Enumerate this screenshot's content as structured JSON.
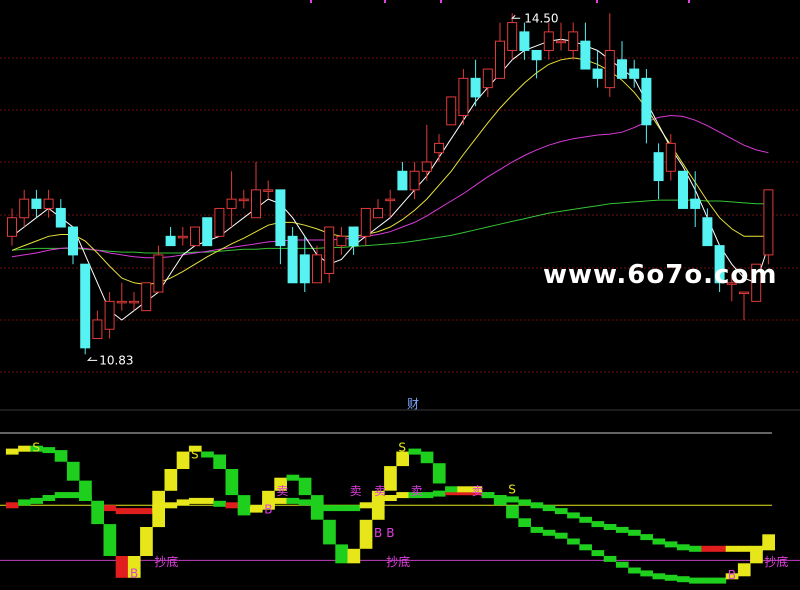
{
  "colors": {
    "background": "#000000",
    "grid": "#6e0f0f",
    "up": "#e03a3a",
    "down": "#57f2f2",
    "ma5": "#ffffff",
    "ma10": "#e8e23a",
    "ma20": "#d93ad9",
    "ma60": "#35c435",
    "green_step": "#1ecf1e",
    "yellow_step": "#e6e61a",
    "red_step": "#e01e1e",
    "magenta_text": "#e040e0",
    "yellow_line": "#e6e61a",
    "magenta_line": "#c040c0",
    "ref_line": "#c8c8c8"
  },
  "watermark": "www.6o7o.com",
  "middle_label": "财",
  "chart_data": [
    {
      "type": "candlestick",
      "price_range": [
        10.5,
        14.6
      ],
      "max_label": "14.50",
      "min_label": "10.83",
      "ohlc": [
        [
          12.1,
          12.4,
          12.0,
          12.3
        ],
        [
          12.3,
          12.6,
          12.2,
          12.5
        ],
        [
          12.5,
          12.6,
          12.3,
          12.4
        ],
        [
          12.4,
          12.6,
          12.3,
          12.5
        ],
        [
          12.4,
          12.5,
          12.2,
          12.2
        ],
        [
          12.2,
          12.2,
          11.8,
          11.9
        ],
        [
          11.8,
          11.8,
          10.83,
          10.9
        ],
        [
          11.0,
          11.3,
          11.0,
          11.2
        ],
        [
          11.1,
          11.5,
          11.0,
          11.4
        ],
        [
          11.4,
          11.6,
          11.3,
          11.4
        ],
        [
          11.4,
          11.5,
          11.3,
          11.4
        ],
        [
          11.3,
          11.6,
          11.3,
          11.6
        ],
        [
          11.5,
          12.0,
          11.5,
          11.9
        ],
        [
          12.1,
          12.2,
          12.0,
          12.0
        ],
        [
          12.1,
          12.2,
          12.0,
          12.1
        ],
        [
          12.0,
          12.2,
          12.0,
          12.2
        ],
        [
          12.3,
          12.3,
          12.0,
          12.0
        ],
        [
          12.1,
          12.4,
          12.1,
          12.4
        ],
        [
          12.4,
          12.8,
          12.2,
          12.5
        ],
        [
          12.5,
          12.6,
          12.4,
          12.5
        ],
        [
          12.3,
          12.9,
          12.3,
          12.6
        ],
        [
          12.6,
          12.7,
          12.5,
          12.6
        ],
        [
          12.6,
          12.6,
          11.8,
          12.0
        ],
        [
          12.1,
          12.2,
          11.6,
          11.6
        ],
        [
          11.9,
          12.1,
          11.5,
          11.6
        ],
        [
          11.6,
          12.0,
          11.6,
          11.9
        ],
        [
          11.7,
          12.2,
          11.6,
          12.2
        ],
        [
          12.0,
          12.2,
          11.9,
          12.1
        ],
        [
          12.2,
          12.2,
          11.9,
          12.0
        ],
        [
          12.1,
          12.4,
          12.0,
          12.4
        ],
        [
          12.3,
          12.5,
          12.3,
          12.4
        ],
        [
          12.5,
          12.6,
          12.3,
          12.5
        ],
        [
          12.8,
          12.9,
          12.6,
          12.6
        ],
        [
          12.6,
          12.9,
          12.5,
          12.8
        ],
        [
          12.8,
          13.3,
          12.7,
          12.9
        ],
        [
          13.0,
          13.2,
          12.9,
          13.1
        ],
        [
          13.3,
          13.6,
          13.3,
          13.6
        ],
        [
          13.4,
          13.9,
          13.3,
          13.8
        ],
        [
          13.8,
          14.0,
          13.5,
          13.6
        ],
        [
          13.7,
          13.9,
          13.6,
          13.9
        ],
        [
          13.8,
          14.4,
          13.8,
          14.2
        ],
        [
          14.1,
          14.5,
          14.0,
          14.4
        ],
        [
          14.3,
          14.4,
          14.0,
          14.1
        ],
        [
          14.1,
          14.1,
          13.8,
          14.0
        ],
        [
          14.1,
          14.4,
          14.0,
          14.3
        ],
        [
          14.2,
          14.4,
          14.1,
          14.2
        ],
        [
          14.1,
          14.4,
          14.0,
          14.3
        ],
        [
          14.2,
          14.4,
          14.0,
          13.9
        ],
        [
          13.9,
          14.1,
          13.7,
          13.8
        ],
        [
          13.7,
          14.5,
          13.6,
          14.1
        ],
        [
          14.0,
          14.2,
          13.8,
          13.8
        ],
        [
          13.9,
          14.0,
          13.7,
          13.8
        ],
        [
          13.8,
          13.9,
          13.1,
          13.3
        ],
        [
          13.0,
          13.1,
          12.5,
          12.7
        ],
        [
          12.8,
          13.2,
          12.7,
          13.1
        ],
        [
          12.8,
          12.8,
          12.4,
          12.4
        ],
        [
          12.5,
          12.8,
          12.2,
          12.4
        ],
        [
          12.3,
          12.4,
          12.0,
          12.0
        ],
        [
          12.0,
          12.0,
          11.5,
          11.6
        ],
        [
          11.6,
          11.7,
          11.4,
          11.6
        ],
        [
          11.5,
          11.5,
          11.2,
          11.5
        ],
        [
          11.4,
          11.7,
          11.4,
          11.8
        ],
        [
          11.9,
          12.3,
          11.8,
          12.6
        ]
      ],
      "ma5": [
        12.1,
        12.2,
        12.3,
        12.4,
        12.3,
        12.2,
        11.9,
        11.6,
        11.3,
        11.2,
        11.3,
        11.4,
        11.5,
        11.7,
        11.9,
        12.0,
        12.05,
        12.1,
        12.2,
        12.3,
        12.4,
        12.5,
        12.45,
        12.3,
        12.1,
        11.9,
        11.8,
        11.85,
        12.0,
        12.1,
        12.2,
        12.3,
        12.45,
        12.6,
        12.75,
        12.95,
        13.15,
        13.35,
        13.55,
        13.7,
        13.85,
        14.0,
        14.1,
        14.15,
        14.2,
        14.22,
        14.2,
        14.15,
        14.1,
        14.0,
        13.9,
        13.8,
        13.55,
        13.3,
        13.05,
        12.85,
        12.6,
        12.3,
        12.0,
        11.8,
        11.65,
        11.6,
        12.0
      ],
      "ma10": [
        11.95,
        12.0,
        12.05,
        12.1,
        12.12,
        12.12,
        12.05,
        11.92,
        11.78,
        11.65,
        11.6,
        11.58,
        11.6,
        11.65,
        11.72,
        11.8,
        11.88,
        11.95,
        12.02,
        12.08,
        12.15,
        12.22,
        12.25,
        12.25,
        12.22,
        12.18,
        12.13,
        12.1,
        12.1,
        12.12,
        12.15,
        12.2,
        12.28,
        12.38,
        12.5,
        12.65,
        12.8,
        12.98,
        13.15,
        13.32,
        13.48,
        13.62,
        13.75,
        13.86,
        13.95,
        14.0,
        14.02,
        14.0,
        13.95,
        13.88,
        13.78,
        13.65,
        13.48,
        13.28,
        13.08,
        12.88,
        12.68,
        12.48,
        12.3,
        12.18,
        12.1,
        12.1,
        12.1
      ],
      "ma20": [
        11.88,
        11.9,
        11.92,
        11.95,
        11.97,
        11.98,
        11.97,
        11.95,
        11.92,
        11.9,
        11.88,
        11.87,
        11.87,
        11.88,
        11.9,
        11.92,
        11.94,
        11.96,
        11.98,
        12.0,
        12.02,
        12.04,
        12.05,
        12.06,
        12.06,
        12.06,
        12.06,
        12.07,
        12.08,
        12.1,
        12.12,
        12.15,
        12.2,
        12.25,
        12.32,
        12.4,
        12.48,
        12.56,
        12.65,
        12.74,
        12.82,
        12.9,
        12.97,
        13.03,
        13.08,
        13.12,
        13.15,
        13.17,
        13.19,
        13.2,
        13.22,
        13.27,
        13.33,
        13.38,
        13.4,
        13.39,
        13.35,
        13.29,
        13.22,
        13.15,
        13.08,
        13.03,
        13.0
      ],
      "ma60": [
        11.95,
        11.96,
        11.97,
        11.97,
        11.97,
        11.97,
        11.96,
        11.95,
        11.94,
        11.93,
        11.93,
        11.92,
        11.92,
        11.92,
        11.92,
        11.93,
        11.93,
        11.94,
        11.95,
        11.96,
        11.96,
        11.97,
        11.97,
        11.97,
        11.97,
        11.97,
        11.98,
        11.98,
        11.99,
        12.0,
        12.01,
        12.02,
        12.03,
        12.05,
        12.07,
        12.09,
        12.11,
        12.14,
        12.17,
        12.2,
        12.23,
        12.26,
        12.29,
        12.32,
        12.35,
        12.37,
        12.39,
        12.41,
        12.43,
        12.45,
        12.46,
        12.47,
        12.48,
        12.49,
        12.49,
        12.49,
        12.49,
        12.48,
        12.48,
        12.47,
        12.46,
        12.45,
        12.45
      ]
    },
    {
      "type": "step-indicator",
      "value_range": [
        0,
        100
      ],
      "levels": {
        "ref": 96,
        "yellow": 55,
        "magenta": 17
      },
      "fast": [
        [
          92,
          "y"
        ],
        [
          94,
          "y"
        ],
        [
          94,
          "g"
        ],
        [
          93,
          "g"
        ],
        [
          85,
          "g"
        ],
        [
          72,
          "g"
        ],
        [
          58,
          "g"
        ],
        [
          42,
          "g"
        ],
        [
          20,
          "g"
        ],
        [
          5,
          "r"
        ],
        [
          20,
          "y"
        ],
        [
          40,
          "y"
        ],
        [
          65,
          "y"
        ],
        [
          80,
          "y"
        ],
        [
          92,
          "y"
        ],
        [
          94,
          "y"
        ],
        [
          90,
          "g"
        ],
        [
          80,
          "g"
        ],
        [
          62,
          "g"
        ],
        [
          48,
          "g"
        ],
        [
          52,
          "y"
        ],
        [
          65,
          "y"
        ],
        [
          74,
          "y"
        ],
        [
          74,
          "g"
        ],
        [
          62,
          "g"
        ],
        [
          45,
          "g"
        ],
        [
          28,
          "g"
        ],
        [
          15,
          "g"
        ],
        [
          25,
          "y"
        ],
        [
          45,
          "y"
        ],
        [
          65,
          "y"
        ],
        [
          82,
          "y"
        ],
        [
          92,
          "y"
        ],
        [
          92,
          "g"
        ],
        [
          84,
          "g"
        ],
        [
          70,
          "g"
        ],
        [
          66,
          "g"
        ],
        [
          66,
          "y"
        ],
        [
          66,
          "y"
        ],
        [
          62,
          "g"
        ],
        [
          55,
          "g"
        ],
        [
          46,
          "g"
        ],
        [
          40,
          "g"
        ],
        [
          38,
          "g"
        ],
        [
          36,
          "g"
        ],
        [
          34,
          "g"
        ],
        [
          30,
          "g"
        ],
        [
          26,
          "g"
        ],
        [
          22,
          "g"
        ],
        [
          18,
          "g"
        ],
        [
          14,
          "g"
        ],
        [
          10,
          "g"
        ],
        [
          8,
          "g"
        ],
        [
          6,
          "g"
        ],
        [
          5,
          "g"
        ],
        [
          4,
          "g"
        ],
        [
          3,
          "g"
        ],
        [
          3,
          "g"
        ],
        [
          3,
          "g"
        ],
        [
          6,
          "y"
        ],
        [
          15,
          "y"
        ],
        [
          25,
          "y"
        ],
        [
          35,
          "y"
        ]
      ],
      "slow": [
        [
          55,
          "r"
        ],
        [
          57,
          "g"
        ],
        [
          58,
          "g"
        ],
        [
          60,
          "g"
        ],
        [
          62,
          "g"
        ],
        [
          62,
          "g"
        ],
        [
          60,
          "g"
        ],
        [
          56,
          "g"
        ],
        [
          53,
          "r"
        ],
        [
          51,
          "r"
        ],
        [
          51,
          "r"
        ],
        [
          51,
          "r"
        ],
        [
          53,
          "y"
        ],
        [
          55,
          "y"
        ],
        [
          57,
          "y"
        ],
        [
          58,
          "y"
        ],
        [
          58,
          "y"
        ],
        [
          56,
          "g"
        ],
        [
          55,
          "r"
        ],
        [
          52,
          "r"
        ],
        [
          53,
          "y"
        ],
        [
          55,
          "y"
        ],
        [
          58,
          "y"
        ],
        [
          58,
          "g"
        ],
        [
          57,
          "g"
        ],
        [
          55,
          "g"
        ],
        [
          53,
          "g"
        ],
        [
          53,
          "g"
        ],
        [
          53,
          "g"
        ],
        [
          55,
          "y"
        ],
        [
          57,
          "y"
        ],
        [
          60,
          "y"
        ],
        [
          62,
          "y"
        ],
        [
          62,
          "g"
        ],
        [
          62,
          "g"
        ],
        [
          63,
          "g"
        ],
        [
          64,
          "r"
        ],
        [
          64,
          "r"
        ],
        [
          64,
          "r"
        ],
        [
          62,
          "g"
        ],
        [
          60,
          "g"
        ],
        [
          59,
          "g"
        ],
        [
          57,
          "g"
        ],
        [
          55,
          "g"
        ],
        [
          53,
          "g"
        ],
        [
          51,
          "g"
        ],
        [
          48,
          "g"
        ],
        [
          45,
          "g"
        ],
        [
          42,
          "g"
        ],
        [
          40,
          "g"
        ],
        [
          38,
          "g"
        ],
        [
          36,
          "g"
        ],
        [
          33,
          "g"
        ],
        [
          30,
          "g"
        ],
        [
          28,
          "g"
        ],
        [
          26,
          "g"
        ],
        [
          25,
          "g"
        ],
        [
          25,
          "r"
        ],
        [
          25,
          "r"
        ],
        [
          25,
          "y"
        ],
        [
          25,
          "y"
        ],
        [
          25,
          "y"
        ],
        [
          26,
          "y"
        ]
      ],
      "annotations": [
        {
          "text": "S",
          "index": 2,
          "value": 95,
          "color": "#e6e61a"
        },
        {
          "text": "S",
          "index": 15,
          "value": 90,
          "color": "#e6e61a"
        },
        {
          "text": "S",
          "index": 32,
          "value": 95,
          "color": "#e6e61a"
        },
        {
          "text": "S",
          "index": 41,
          "value": 66,
          "color": "#e6e61a"
        },
        {
          "text": "卖",
          "index": 22,
          "value": 65,
          "color": "#e040e0"
        },
        {
          "text": "卖",
          "index": 28,
          "value": 65,
          "color": "#e040e0"
        },
        {
          "text": "卖",
          "index": 30,
          "value": 65,
          "color": "#e040e0"
        },
        {
          "text": "卖",
          "index": 33,
          "value": 65,
          "color": "#e040e0"
        },
        {
          "text": "卖",
          "index": 38,
          "value": 65,
          "color": "#e040e0"
        },
        {
          "text": "B",
          "index": 21,
          "value": 52,
          "color": "#e040e0"
        },
        {
          "text": "B",
          "index": 30,
          "value": 36,
          "color": "#e040e0"
        },
        {
          "text": "B",
          "index": 31,
          "value": 36,
          "color": "#e040e0"
        },
        {
          "text": "B",
          "index": 10,
          "value": 8,
          "color": "#e040e0"
        },
        {
          "text": "B",
          "index": 59,
          "value": 7,
          "color": "#e040e0"
        },
        {
          "text": "抄底",
          "index": 12,
          "value": 16,
          "color": "#e040e0"
        },
        {
          "text": "抄底",
          "index": 31,
          "value": 16,
          "color": "#e040e0"
        },
        {
          "text": "抄底",
          "index": 62,
          "value": 16,
          "color": "#e040e0"
        }
      ]
    }
  ]
}
